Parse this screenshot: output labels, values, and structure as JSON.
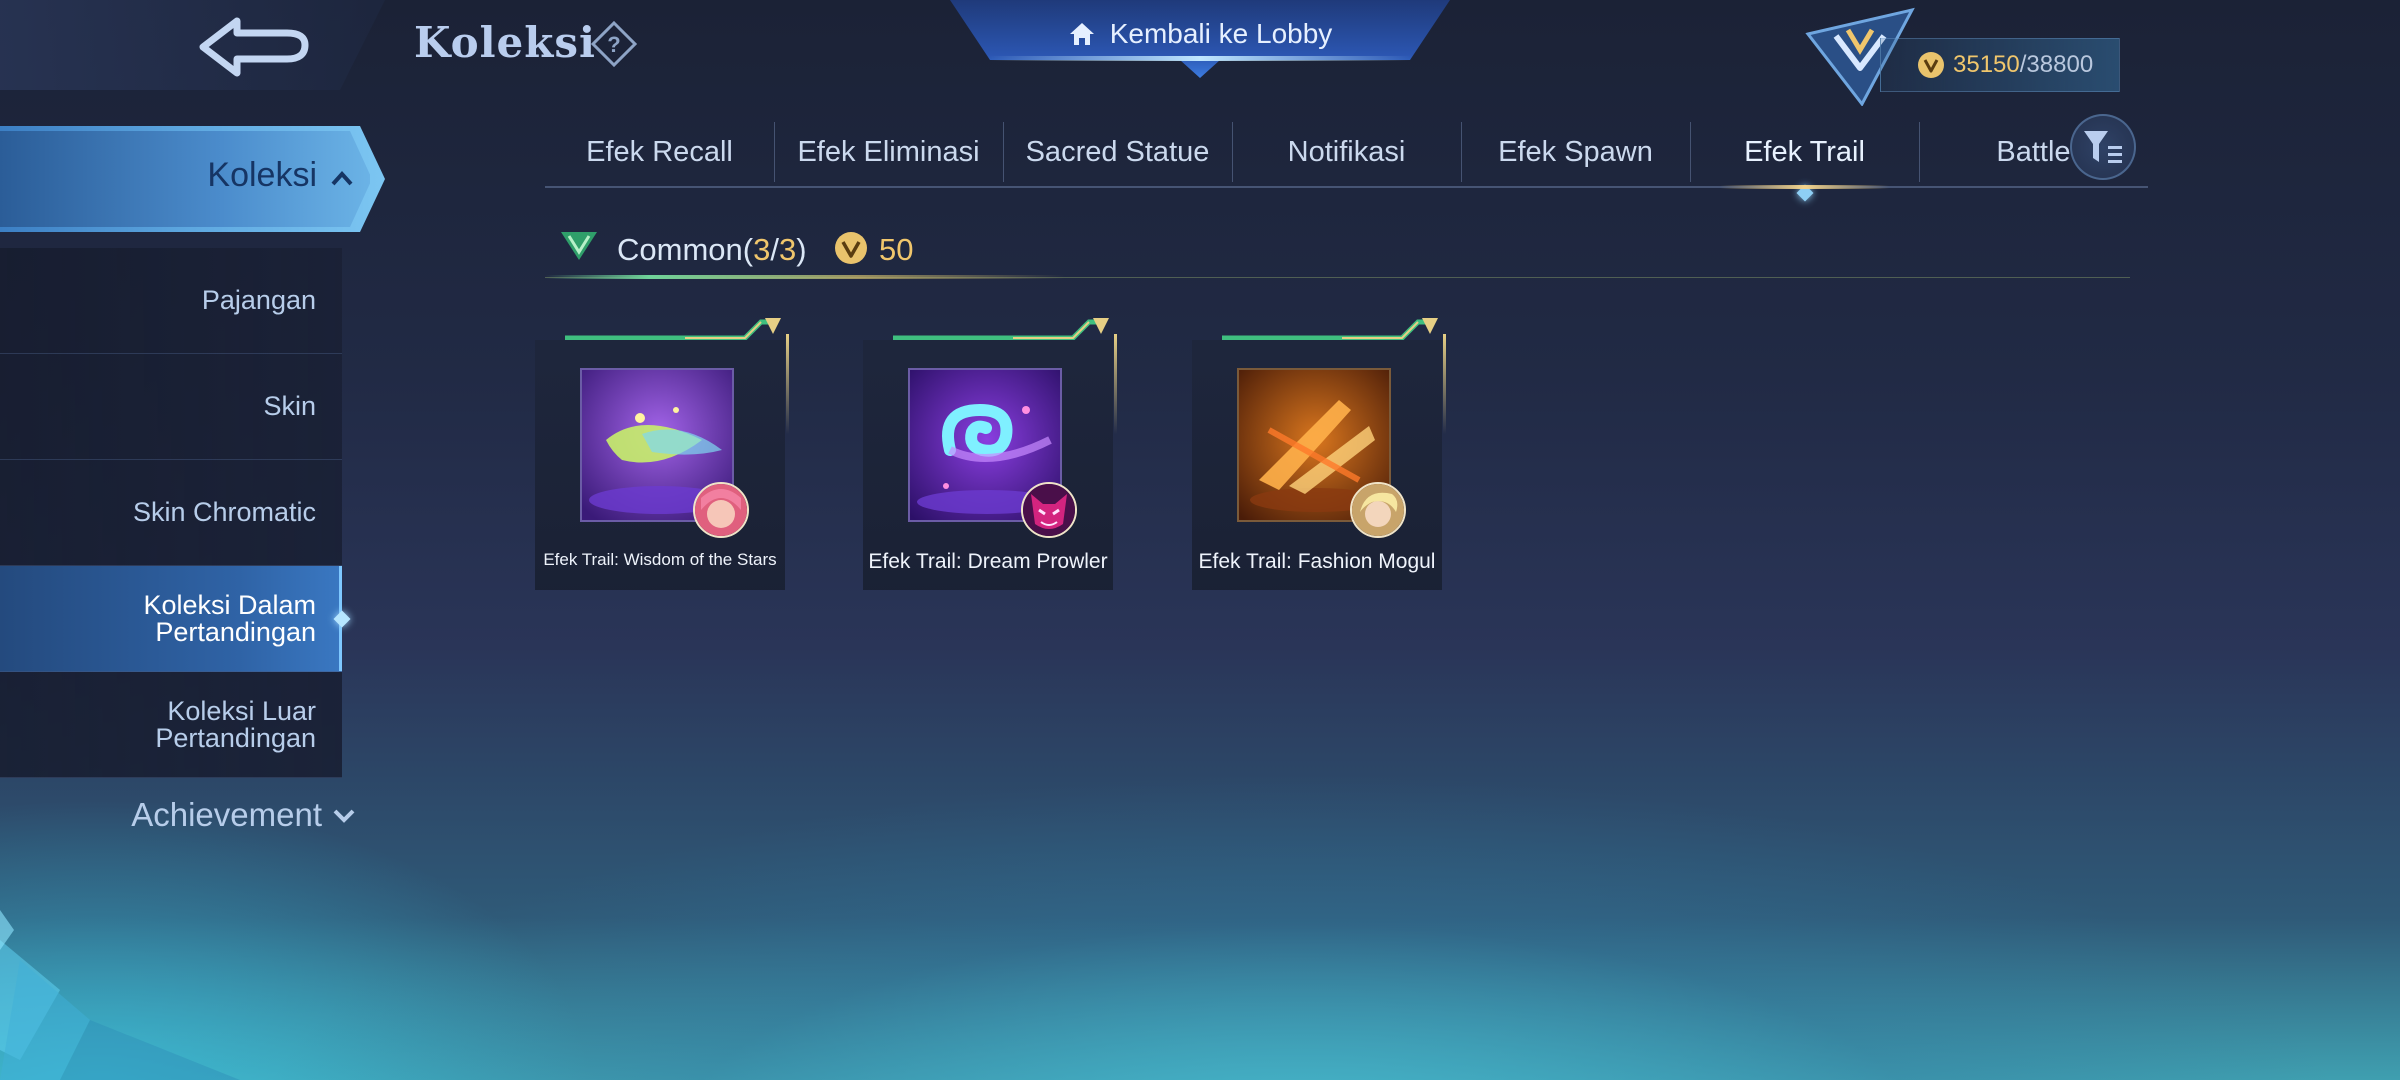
{
  "header": {
    "title": "Koleksi",
    "lobby_label": "Kembali ke Lobby",
    "points_current": "35150",
    "points_separator": "/",
    "points_max": "38800"
  },
  "sidebar": {
    "main_label": "Koleksi",
    "items": [
      {
        "label": "Pajangan"
      },
      {
        "label": "Skin"
      },
      {
        "label": "Skin Chromatic"
      },
      {
        "label_line1": "Koleksi Dalam",
        "label_line2": "Pertandingan",
        "active": true
      },
      {
        "label_line1": "Koleksi Luar",
        "label_line2": "Pertandingan"
      }
    ],
    "achievement_label": "Achievement"
  },
  "tabs": [
    {
      "label": "Efek Recall"
    },
    {
      "label": "Efek Eliminasi"
    },
    {
      "label": "Sacred Statue"
    },
    {
      "label": "Notifikasi"
    },
    {
      "label": "Efek Spawn"
    },
    {
      "label": "Efek Trail",
      "active": true
    },
    {
      "label": "Battle"
    }
  ],
  "section": {
    "title_prefix": "Common(",
    "owned": "3",
    "slash": "/",
    "total": "3",
    "title_suffix": ")",
    "points": "50"
  },
  "items": [
    {
      "name": "Efek Trail: Wisdom of the Stars"
    },
    {
      "name": "Efek Trail: Dream Prowler"
    },
    {
      "name": "Efek Trail: Fashion Mogul"
    }
  ],
  "colors": {
    "accent_gold": "#f0c66c",
    "active_blue": "#3a78c2",
    "text_light": "#dce6f5"
  },
  "icons": {
    "back": "back-arrow-icon",
    "help": "question-icon",
    "home": "home-icon",
    "rank": "rank-emblem-icon",
    "coin": "collection-coin-icon",
    "filter": "filter-icon",
    "caret_up": "chevron-up-icon",
    "caret_down": "chevron-down-icon"
  }
}
